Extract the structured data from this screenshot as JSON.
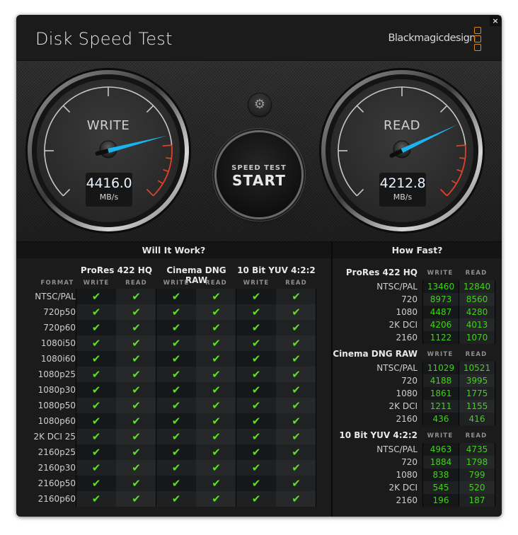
{
  "window": {
    "title": "Disk Speed Test",
    "brand": "Blackmagicdesign",
    "close_label": "×",
    "brand_color": "#d98a1c"
  },
  "gauges": {
    "write": {
      "label": "WRITE",
      "value": "4416.0",
      "unit": "MB/s",
      "needle_fraction": 0.78
    },
    "read": {
      "label": "READ",
      "value": "4212.8",
      "unit": "MB/s",
      "needle_fraction": 0.74
    },
    "needle_color": "#1ab4ef",
    "redzone_color": "#e0412b"
  },
  "controls": {
    "settings_icon": "gear-icon",
    "settings_glyph": "⚙",
    "start_sub": "SPEED TEST",
    "start_main": "START"
  },
  "will_it_work": {
    "title": "Will It Work?",
    "format_header": "FORMAT",
    "groups": [
      "ProRes 422 HQ",
      "Cinema DNG RAW",
      "10 Bit YUV 4:2:2"
    ],
    "sub_headers": [
      "WRITE",
      "READ"
    ],
    "check_glyph": "✔",
    "check_color": "#5ae21f",
    "rows": [
      {
        "format": "NTSC/PAL",
        "checks": [
          true,
          true,
          true,
          true,
          true,
          true
        ]
      },
      {
        "format": "720p50",
        "checks": [
          true,
          true,
          true,
          true,
          true,
          true
        ]
      },
      {
        "format": "720p60",
        "checks": [
          true,
          true,
          true,
          true,
          true,
          true
        ]
      },
      {
        "format": "1080i50",
        "checks": [
          true,
          true,
          true,
          true,
          true,
          true
        ]
      },
      {
        "format": "1080i60",
        "checks": [
          true,
          true,
          true,
          true,
          true,
          true
        ]
      },
      {
        "format": "1080p25",
        "checks": [
          true,
          true,
          true,
          true,
          true,
          true
        ]
      },
      {
        "format": "1080p30",
        "checks": [
          true,
          true,
          true,
          true,
          true,
          true
        ]
      },
      {
        "format": "1080p50",
        "checks": [
          true,
          true,
          true,
          true,
          true,
          true
        ]
      },
      {
        "format": "1080p60",
        "checks": [
          true,
          true,
          true,
          true,
          true,
          true
        ]
      },
      {
        "format": "2K DCI 25",
        "checks": [
          true,
          true,
          true,
          true,
          true,
          true
        ]
      },
      {
        "format": "2160p25",
        "checks": [
          true,
          true,
          true,
          true,
          true,
          true
        ]
      },
      {
        "format": "2160p30",
        "checks": [
          true,
          true,
          true,
          true,
          true,
          true
        ]
      },
      {
        "format": "2160p50",
        "checks": [
          true,
          true,
          true,
          true,
          true,
          true
        ]
      },
      {
        "format": "2160p60",
        "checks": [
          true,
          true,
          true,
          true,
          true,
          true
        ]
      }
    ]
  },
  "how_fast": {
    "title": "How Fast?",
    "col_write": "WRITE",
    "col_read": "READ",
    "value_color": "#43d11e",
    "groups": [
      {
        "name": "ProRes 422 HQ",
        "rows": [
          {
            "label": "NTSC/PAL",
            "write": "13460",
            "read": "12840"
          },
          {
            "label": "720",
            "write": "8973",
            "read": "8560"
          },
          {
            "label": "1080",
            "write": "4487",
            "read": "4280"
          },
          {
            "label": "2K DCI",
            "write": "4206",
            "read": "4013"
          },
          {
            "label": "2160",
            "write": "1122",
            "read": "1070"
          }
        ]
      },
      {
        "name": "Cinema DNG RAW",
        "rows": [
          {
            "label": "NTSC/PAL",
            "write": "11029",
            "read": "10521"
          },
          {
            "label": "720",
            "write": "4188",
            "read": "3995"
          },
          {
            "label": "1080",
            "write": "1861",
            "read": "1775"
          },
          {
            "label": "2K DCI",
            "write": "1211",
            "read": "1155"
          },
          {
            "label": "2160",
            "write": "436",
            "read": "416"
          }
        ]
      },
      {
        "name": "10 Bit YUV 4:2:2",
        "rows": [
          {
            "label": "NTSC/PAL",
            "write": "4963",
            "read": "4735"
          },
          {
            "label": "720",
            "write": "1884",
            "read": "1798"
          },
          {
            "label": "1080",
            "write": "838",
            "read": "799"
          },
          {
            "label": "2K DCI",
            "write": "545",
            "read": "520"
          },
          {
            "label": "2160",
            "write": "196",
            "read": "187"
          }
        ]
      }
    ]
  }
}
